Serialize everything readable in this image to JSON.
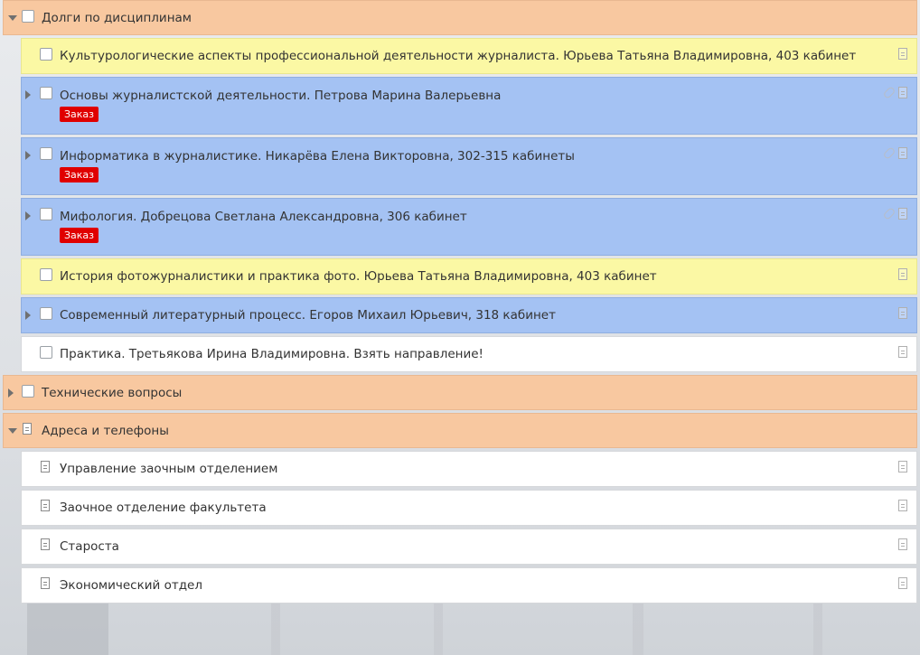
{
  "groups": [
    {
      "title": "Долги по дисциплинам",
      "expanded": true,
      "lead": "checkbox",
      "items": [
        {
          "label": "Культурологические аспекты профессиональной деятельности журналиста. Юрьева Татьяна Владимировна, 403 кабинет",
          "color": "yellow",
          "expandable": false,
          "badge": "",
          "clip": false
        },
        {
          "label": "Основы журналистской деятельности. Петрова Марина Валерьевна",
          "color": "blue",
          "expandable": true,
          "badge": "Заказ",
          "clip": true
        },
        {
          "label": "Информатика в журналистике. Никарёва Елена Викторовна, 302-315 кабинеты",
          "color": "blue",
          "expandable": true,
          "badge": "Заказ",
          "clip": true
        },
        {
          "label": "Мифология. Добрецова Светлана Александровна, 306 кабинет",
          "color": "blue",
          "expandable": true,
          "badge": "Заказ",
          "clip": true
        },
        {
          "label": "История фотожурналистики и практика фото. Юрьева Татьяна Владимировна, 403 кабинет",
          "color": "yellow",
          "expandable": false,
          "badge": "",
          "clip": false
        },
        {
          "label": "Современный литературный процесс. Егоров Михаил Юрьевич, 318 кабинет",
          "color": "blue",
          "expandable": true,
          "badge": "",
          "clip": false
        },
        {
          "label": "Практика. Третьякова Ирина Владимировна. Взять направление!",
          "color": "white",
          "expandable": false,
          "badge": "",
          "clip": false
        }
      ]
    },
    {
      "title": "Технические вопросы",
      "expanded": false,
      "lead": "checkbox",
      "items": []
    },
    {
      "title": "Адреса и телефоны",
      "expanded": true,
      "lead": "document",
      "items": [
        {
          "label": "Управление заочным отделением",
          "color": "white",
          "lead": "document"
        },
        {
          "label": "Заочное отделение факультета",
          "color": "white",
          "lead": "document"
        },
        {
          "label": "Староста",
          "color": "white",
          "lead": "document"
        },
        {
          "label": "Экономический отдел",
          "color": "white",
          "lead": "document"
        }
      ]
    }
  ],
  "icons": {
    "expand": "triangle-right-icon",
    "collapse": "triangle-down-icon",
    "note": "note-icon",
    "attachment": "paperclip-icon",
    "document": "document-icon"
  },
  "colors": {
    "group": "#f8c8a0",
    "yellow": "#fbf8a4",
    "blue": "#a4c2f3",
    "white": "#ffffff",
    "badge": "#e00000"
  }
}
